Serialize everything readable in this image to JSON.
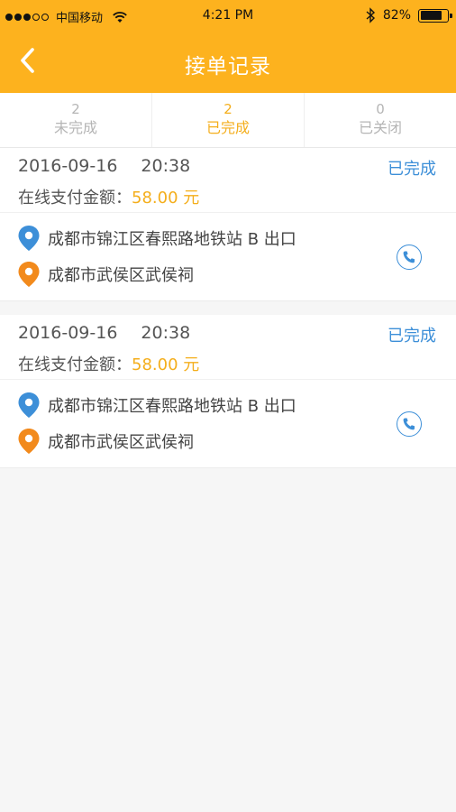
{
  "status_bar": {
    "carrier": "中国移动",
    "time": "4:21 PM",
    "battery_percent": "82%",
    "battery_level": 0.82,
    "signal_bars_filled": 3,
    "signal_bars_total": 5
  },
  "header": {
    "title": "接单记录",
    "background_color": "#fdb21e"
  },
  "tabs": [
    {
      "count": "2",
      "label": "未完成",
      "active": false
    },
    {
      "count": "2",
      "label": "已完成",
      "active": true
    },
    {
      "count": "0",
      "label": "已关闭",
      "active": false
    }
  ],
  "orders": [
    {
      "date": "2016-09-16",
      "time": "20:38",
      "status": "已完成",
      "pay_label": "在线支付金额：",
      "amount": "58.00 元",
      "from": "成都市锦江区春熙路地铁站 B 出口",
      "to": "成都市武侯区武侯祠"
    },
    {
      "date": "2016-09-16",
      "time": "20:38",
      "status": "已完成",
      "pay_label": "在线支付金额：",
      "amount": "58.00 元",
      "from": "成都市锦江区春熙路地铁站 B 出口",
      "to": "成都市武侯区武侯祠"
    }
  ],
  "icons": {
    "back": "chevron-left-icon",
    "from": "location-pin-blue-icon",
    "to": "location-pin-orange-icon",
    "phone": "phone-icon"
  },
  "colors": {
    "accent": "#f4ae1c",
    "status_blue": "#3d8fd8",
    "from_pin": "#3d8fd8",
    "to_pin": "#f28a1c"
  }
}
